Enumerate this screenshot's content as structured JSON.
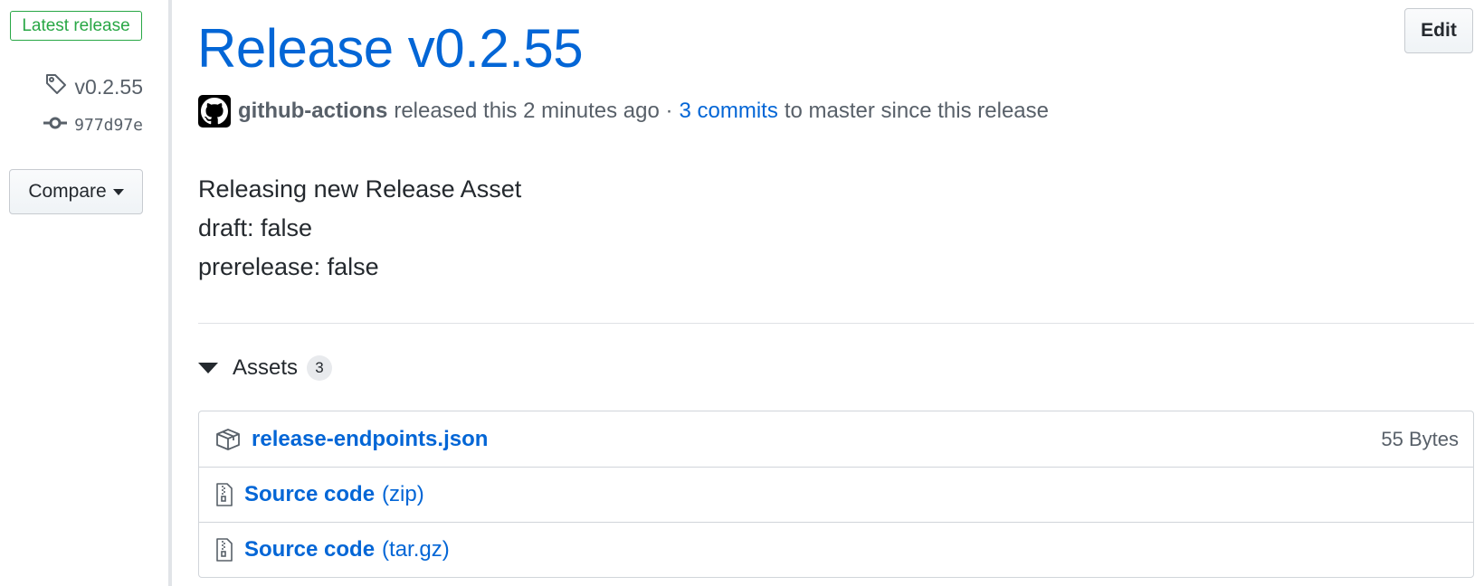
{
  "sidebar": {
    "latest_badge": "Latest release",
    "tag": "v0.2.55",
    "commit": "977d97e",
    "compare_label": "Compare"
  },
  "release": {
    "title": "Release v0.2.55",
    "edit_label": "Edit",
    "author": "github-actions",
    "released_text": "released this 2 minutes ago ·",
    "commits_link": "3 commits",
    "commits_suffix": "to master since this release",
    "body": [
      "Releasing new Release Asset",
      "draft: false",
      "prerelease: false"
    ]
  },
  "assets": {
    "label": "Assets",
    "count": "3",
    "items": [
      {
        "icon": "package-icon",
        "name": "release-endpoints.json",
        "suffix": "",
        "size": "55 Bytes"
      },
      {
        "icon": "file-zip-icon",
        "name": "Source code",
        "suffix": "(zip)",
        "size": ""
      },
      {
        "icon": "file-zip-icon",
        "name": "Source code",
        "suffix": "(tar.gz)",
        "size": ""
      }
    ]
  },
  "colors": {
    "link": "#0366d6",
    "success": "#28a745",
    "muted": "#586069",
    "border": "#d1d5da"
  }
}
